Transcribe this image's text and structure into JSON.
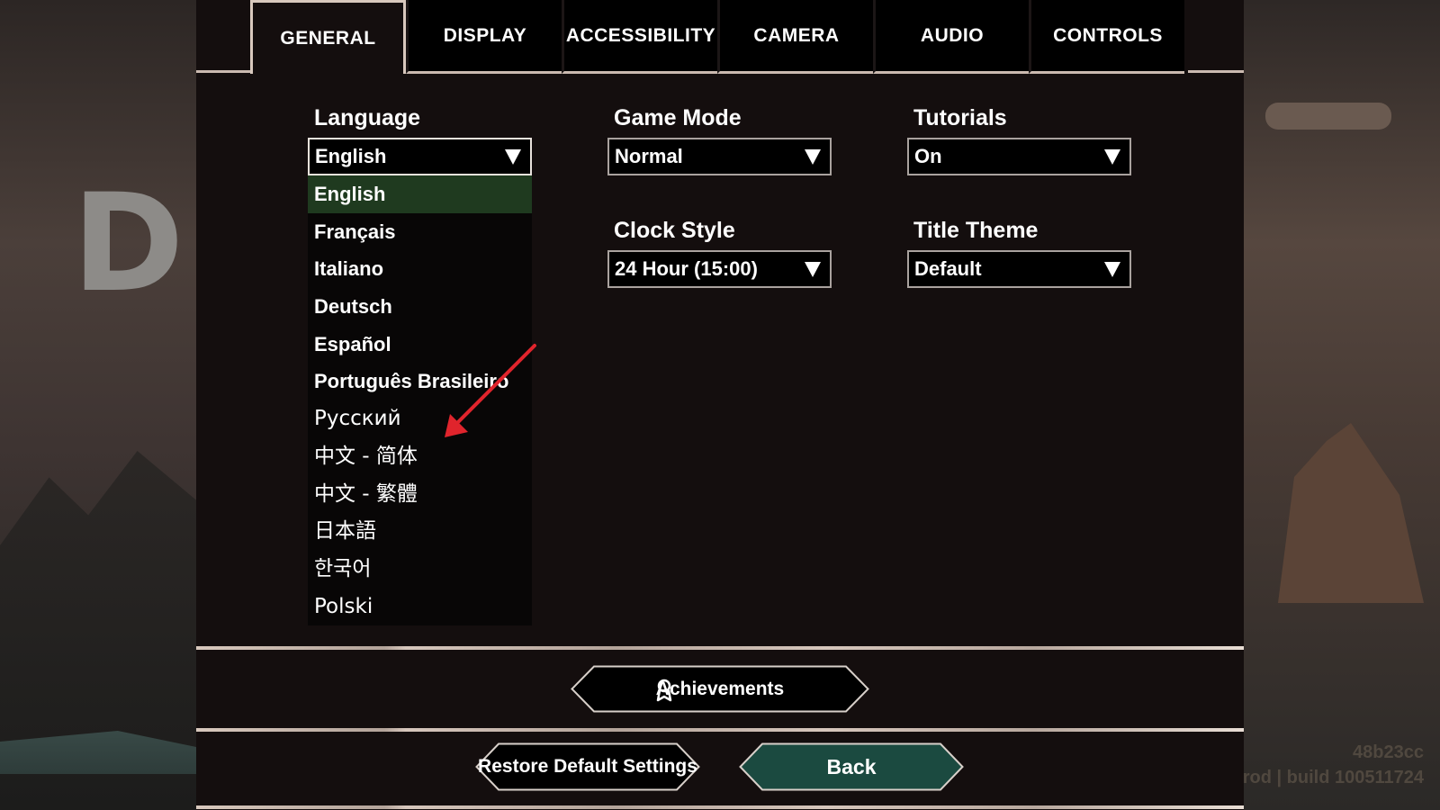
{
  "background": {
    "title_fragment": "DR",
    "build_hash": "48b23cc",
    "build_label": "rod | build 100511724"
  },
  "tabs": [
    {
      "label": "GENERAL",
      "active": true
    },
    {
      "label": "DISPLAY",
      "active": false
    },
    {
      "label": "ACCESSIBILITY",
      "active": false
    },
    {
      "label": "CAMERA",
      "active": false
    },
    {
      "label": "AUDIO",
      "active": false
    },
    {
      "label": "CONTROLS",
      "active": false
    }
  ],
  "settings": {
    "language": {
      "label": "Language",
      "value": "English",
      "open": true
    },
    "game_mode": {
      "label": "Game Mode",
      "value": "Normal"
    },
    "tutorials": {
      "label": "Tutorials",
      "value": "On"
    },
    "clock_style": {
      "label": "Clock Style",
      "value": "24 Hour (15:00)"
    },
    "title_theme": {
      "label": "Title Theme",
      "value": "Default"
    }
  },
  "language_options": [
    "English",
    "Français",
    "Italiano",
    "Deutsch",
    "Español",
    "Português Brasileiro",
    "Русский",
    "中文 - 简体",
    "中文 - 繁體",
    "日本語",
    "한국어",
    "Polski"
  ],
  "buttons": {
    "achievements": "Achievements",
    "restore_defaults": "Restore Default Settings",
    "back": "Back"
  },
  "colors": {
    "panel_bg": "#140e0e",
    "selected_option": "#1f3a1f",
    "back_button": "#1b4a40",
    "annotation_arrow": "#e0242c"
  }
}
